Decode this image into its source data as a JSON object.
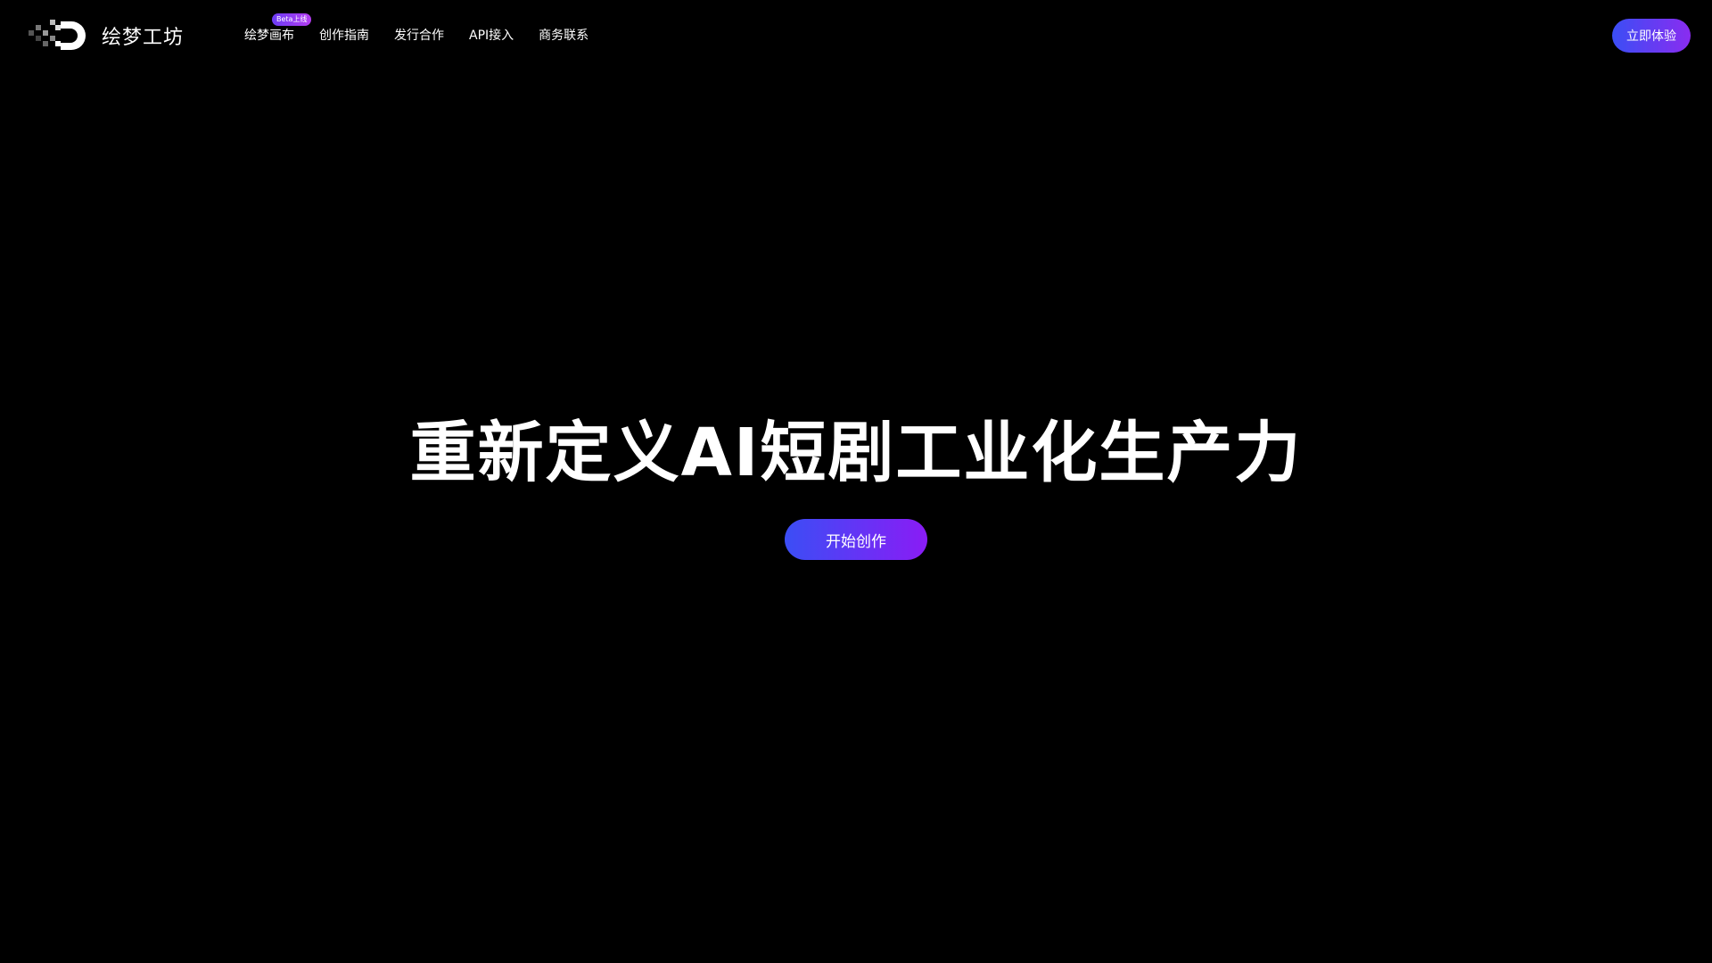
{
  "header": {
    "logo_text": "绘梦工坊",
    "nav": [
      {
        "label": "绘梦画布",
        "badge": "Beta上线"
      },
      {
        "label": "创作指南"
      },
      {
        "label": "发行合作"
      },
      {
        "label": "API接入"
      },
      {
        "label": "商务联系"
      }
    ],
    "cta_label": "立即体验"
  },
  "hero": {
    "title": "重新定义AI短剧工业化生产力",
    "cta_label": "开始创作"
  },
  "colors": {
    "background": "#000000",
    "text": "#ffffff",
    "gradient_start": "#3b4ef5",
    "gradient_end": "#8a1cf5",
    "badge_start": "#6b3cf5",
    "badge_end": "#b43cf0"
  },
  "icons": {
    "logo": "pixel-d-logo-icon"
  }
}
